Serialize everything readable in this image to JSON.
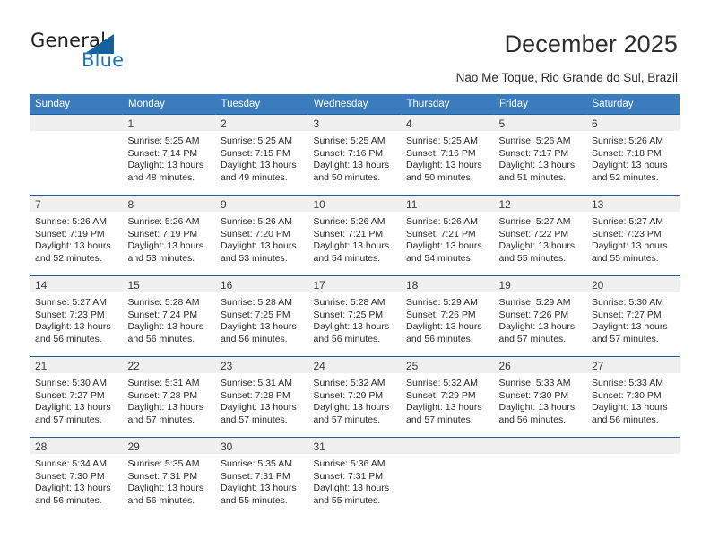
{
  "brand": {
    "name_part1": "General",
    "name_part2": "Blue"
  },
  "header": {
    "title": "December 2025",
    "subtitle": "Nao Me Toque, Rio Grande do Sul, Brazil"
  },
  "colors": {
    "header_blue": "#3a7cbe",
    "logo_blue": "#1f74bd",
    "daynum_band": "#f0f0f0",
    "row_divider": "#1f5f9e"
  },
  "weekday_headers": [
    "Sunday",
    "Monday",
    "Tuesday",
    "Wednesday",
    "Thursday",
    "Friday",
    "Saturday"
  ],
  "weeks": [
    [
      {
        "day": "",
        "empty": true,
        "sunrise": "",
        "sunset": "",
        "daylight_line1": "",
        "daylight_line2": ""
      },
      {
        "day": "1",
        "sunrise": "Sunrise: 5:25 AM",
        "sunset": "Sunset: 7:14 PM",
        "daylight_line1": "Daylight: 13 hours",
        "daylight_line2": "and 48 minutes."
      },
      {
        "day": "2",
        "sunrise": "Sunrise: 5:25 AM",
        "sunset": "Sunset: 7:15 PM",
        "daylight_line1": "Daylight: 13 hours",
        "daylight_line2": "and 49 minutes."
      },
      {
        "day": "3",
        "sunrise": "Sunrise: 5:25 AM",
        "sunset": "Sunset: 7:16 PM",
        "daylight_line1": "Daylight: 13 hours",
        "daylight_line2": "and 50 minutes."
      },
      {
        "day": "4",
        "sunrise": "Sunrise: 5:25 AM",
        "sunset": "Sunset: 7:16 PM",
        "daylight_line1": "Daylight: 13 hours",
        "daylight_line2": "and 50 minutes."
      },
      {
        "day": "5",
        "sunrise": "Sunrise: 5:26 AM",
        "sunset": "Sunset: 7:17 PM",
        "daylight_line1": "Daylight: 13 hours",
        "daylight_line2": "and 51 minutes."
      },
      {
        "day": "6",
        "sunrise": "Sunrise: 5:26 AM",
        "sunset": "Sunset: 7:18 PM",
        "daylight_line1": "Daylight: 13 hours",
        "daylight_line2": "and 52 minutes."
      }
    ],
    [
      {
        "day": "7",
        "sunrise": "Sunrise: 5:26 AM",
        "sunset": "Sunset: 7:19 PM",
        "daylight_line1": "Daylight: 13 hours",
        "daylight_line2": "and 52 minutes."
      },
      {
        "day": "8",
        "sunrise": "Sunrise: 5:26 AM",
        "sunset": "Sunset: 7:19 PM",
        "daylight_line1": "Daylight: 13 hours",
        "daylight_line2": "and 53 minutes."
      },
      {
        "day": "9",
        "sunrise": "Sunrise: 5:26 AM",
        "sunset": "Sunset: 7:20 PM",
        "daylight_line1": "Daylight: 13 hours",
        "daylight_line2": "and 53 minutes."
      },
      {
        "day": "10",
        "sunrise": "Sunrise: 5:26 AM",
        "sunset": "Sunset: 7:21 PM",
        "daylight_line1": "Daylight: 13 hours",
        "daylight_line2": "and 54 minutes."
      },
      {
        "day": "11",
        "sunrise": "Sunrise: 5:26 AM",
        "sunset": "Sunset: 7:21 PM",
        "daylight_line1": "Daylight: 13 hours",
        "daylight_line2": "and 54 minutes."
      },
      {
        "day": "12",
        "sunrise": "Sunrise: 5:27 AM",
        "sunset": "Sunset: 7:22 PM",
        "daylight_line1": "Daylight: 13 hours",
        "daylight_line2": "and 55 minutes."
      },
      {
        "day": "13",
        "sunrise": "Sunrise: 5:27 AM",
        "sunset": "Sunset: 7:23 PM",
        "daylight_line1": "Daylight: 13 hours",
        "daylight_line2": "and 55 minutes."
      }
    ],
    [
      {
        "day": "14",
        "sunrise": "Sunrise: 5:27 AM",
        "sunset": "Sunset: 7:23 PM",
        "daylight_line1": "Daylight: 13 hours",
        "daylight_line2": "and 56 minutes."
      },
      {
        "day": "15",
        "sunrise": "Sunrise: 5:28 AM",
        "sunset": "Sunset: 7:24 PM",
        "daylight_line1": "Daylight: 13 hours",
        "daylight_line2": "and 56 minutes."
      },
      {
        "day": "16",
        "sunrise": "Sunrise: 5:28 AM",
        "sunset": "Sunset: 7:25 PM",
        "daylight_line1": "Daylight: 13 hours",
        "daylight_line2": "and 56 minutes."
      },
      {
        "day": "17",
        "sunrise": "Sunrise: 5:28 AM",
        "sunset": "Sunset: 7:25 PM",
        "daylight_line1": "Daylight: 13 hours",
        "daylight_line2": "and 56 minutes."
      },
      {
        "day": "18",
        "sunrise": "Sunrise: 5:29 AM",
        "sunset": "Sunset: 7:26 PM",
        "daylight_line1": "Daylight: 13 hours",
        "daylight_line2": "and 56 minutes."
      },
      {
        "day": "19",
        "sunrise": "Sunrise: 5:29 AM",
        "sunset": "Sunset: 7:26 PM",
        "daylight_line1": "Daylight: 13 hours",
        "daylight_line2": "and 57 minutes."
      },
      {
        "day": "20",
        "sunrise": "Sunrise: 5:30 AM",
        "sunset": "Sunset: 7:27 PM",
        "daylight_line1": "Daylight: 13 hours",
        "daylight_line2": "and 57 minutes."
      }
    ],
    [
      {
        "day": "21",
        "sunrise": "Sunrise: 5:30 AM",
        "sunset": "Sunset: 7:27 PM",
        "daylight_line1": "Daylight: 13 hours",
        "daylight_line2": "and 57 minutes."
      },
      {
        "day": "22",
        "sunrise": "Sunrise: 5:31 AM",
        "sunset": "Sunset: 7:28 PM",
        "daylight_line1": "Daylight: 13 hours",
        "daylight_line2": "and 57 minutes."
      },
      {
        "day": "23",
        "sunrise": "Sunrise: 5:31 AM",
        "sunset": "Sunset: 7:28 PM",
        "daylight_line1": "Daylight: 13 hours",
        "daylight_line2": "and 57 minutes."
      },
      {
        "day": "24",
        "sunrise": "Sunrise: 5:32 AM",
        "sunset": "Sunset: 7:29 PM",
        "daylight_line1": "Daylight: 13 hours",
        "daylight_line2": "and 57 minutes."
      },
      {
        "day": "25",
        "sunrise": "Sunrise: 5:32 AM",
        "sunset": "Sunset: 7:29 PM",
        "daylight_line1": "Daylight: 13 hours",
        "daylight_line2": "and 57 minutes."
      },
      {
        "day": "26",
        "sunrise": "Sunrise: 5:33 AM",
        "sunset": "Sunset: 7:30 PM",
        "daylight_line1": "Daylight: 13 hours",
        "daylight_line2": "and 56 minutes."
      },
      {
        "day": "27",
        "sunrise": "Sunrise: 5:33 AM",
        "sunset": "Sunset: 7:30 PM",
        "daylight_line1": "Daylight: 13 hours",
        "daylight_line2": "and 56 minutes."
      }
    ],
    [
      {
        "day": "28",
        "sunrise": "Sunrise: 5:34 AM",
        "sunset": "Sunset: 7:30 PM",
        "daylight_line1": "Daylight: 13 hours",
        "daylight_line2": "and 56 minutes."
      },
      {
        "day": "29",
        "sunrise": "Sunrise: 5:35 AM",
        "sunset": "Sunset: 7:31 PM",
        "daylight_line1": "Daylight: 13 hours",
        "daylight_line2": "and 56 minutes."
      },
      {
        "day": "30",
        "sunrise": "Sunrise: 5:35 AM",
        "sunset": "Sunset: 7:31 PM",
        "daylight_line1": "Daylight: 13 hours",
        "daylight_line2": "and 55 minutes."
      },
      {
        "day": "31",
        "sunrise": "Sunrise: 5:36 AM",
        "sunset": "Sunset: 7:31 PM",
        "daylight_line1": "Daylight: 13 hours",
        "daylight_line2": "and 55 minutes."
      },
      {
        "day": "",
        "empty": true,
        "sunrise": "",
        "sunset": "",
        "daylight_line1": "",
        "daylight_line2": ""
      },
      {
        "day": "",
        "empty": true,
        "sunrise": "",
        "sunset": "",
        "daylight_line1": "",
        "daylight_line2": ""
      },
      {
        "day": "",
        "empty": true,
        "sunrise": "",
        "sunset": "",
        "daylight_line1": "",
        "daylight_line2": ""
      }
    ]
  ]
}
